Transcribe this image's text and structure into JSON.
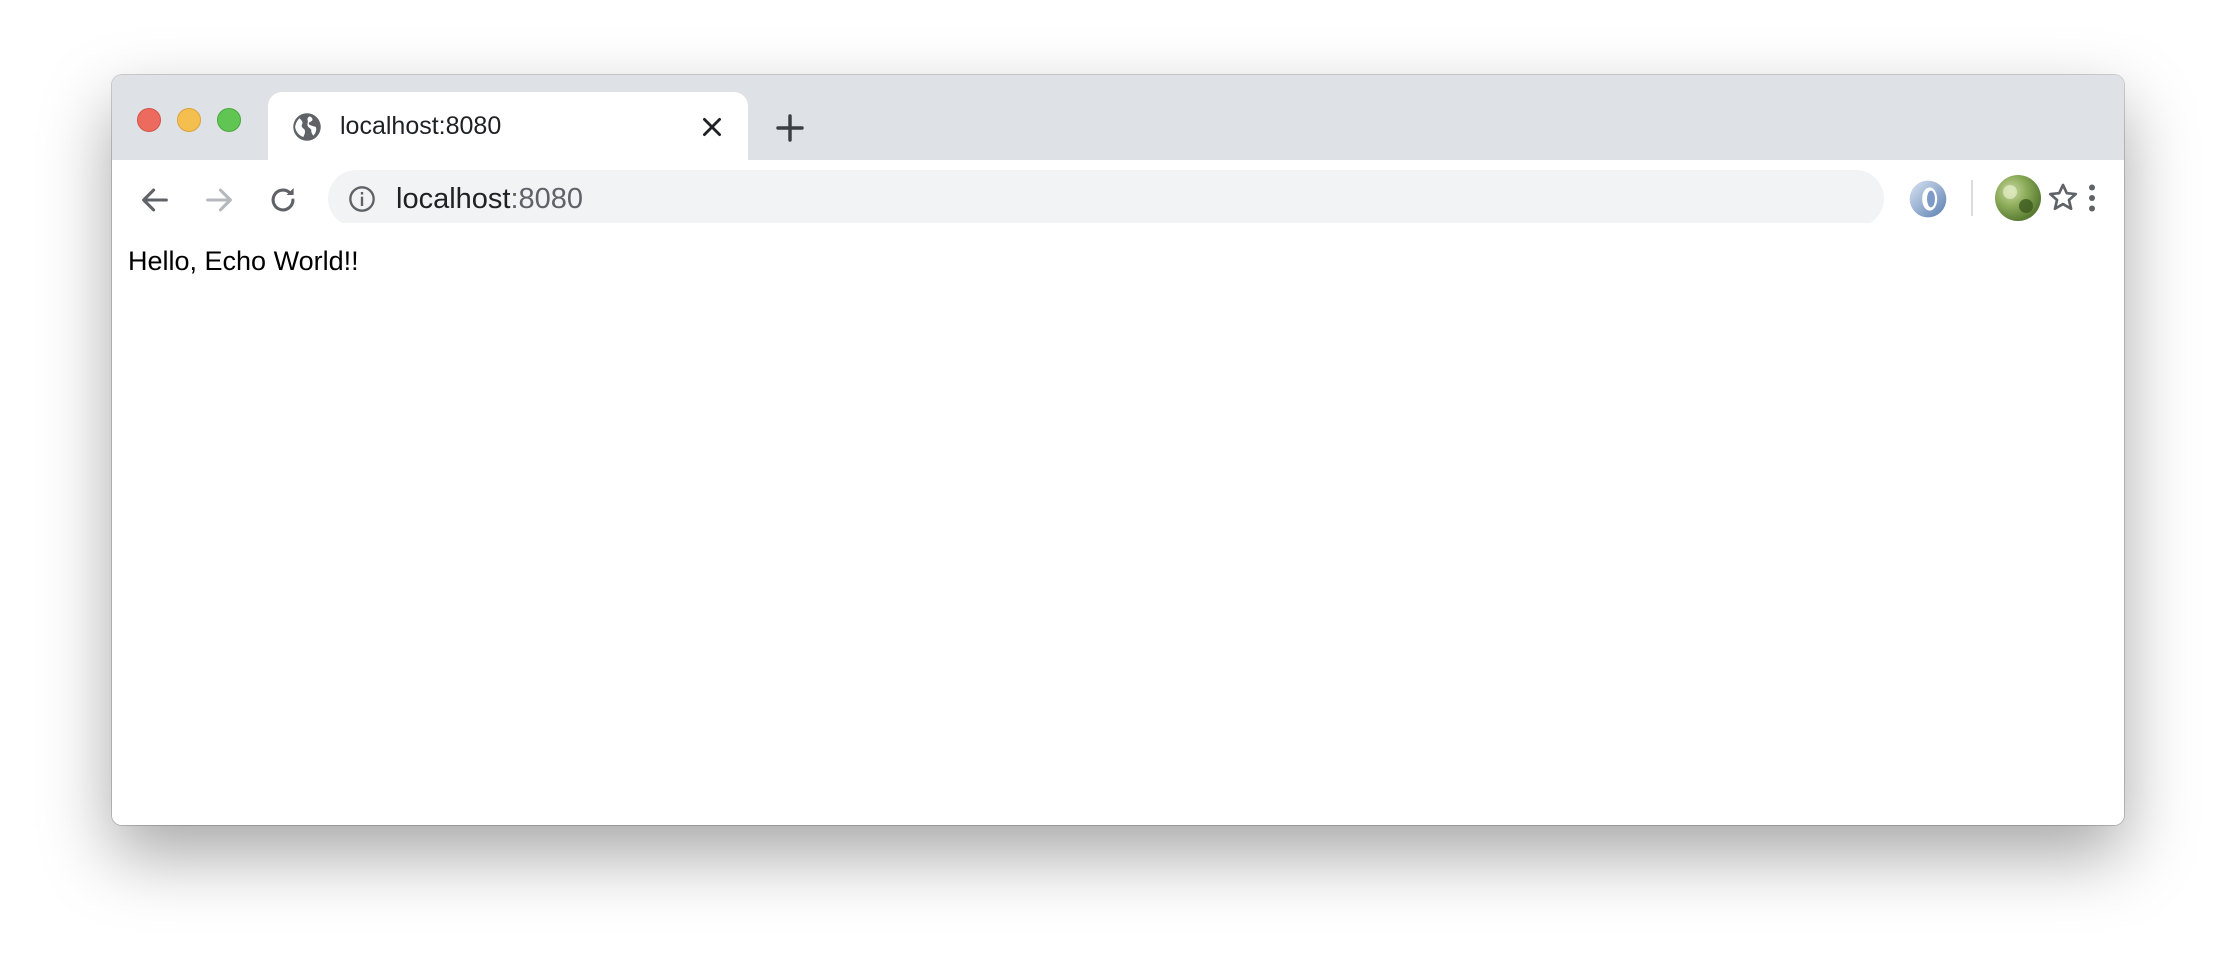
{
  "browser": {
    "tab": {
      "title": "localhost:8080",
      "icon": "globe-icon"
    },
    "address_bar": {
      "host": "localhost",
      "port": ":8080",
      "info_icon": "info-icon"
    },
    "toolbar_icons": [
      "back-arrow-icon",
      "forward-arrow-icon",
      "reload-icon",
      "bookmark-star-icon",
      "extension-icon",
      "profile-avatar",
      "more-menu-icon"
    ],
    "traffic_colors": {
      "close": "#ed6a5e",
      "minimize": "#f5bf4f",
      "maximize": "#61c554"
    }
  },
  "page": {
    "text": "Hello, Echo World!!"
  }
}
